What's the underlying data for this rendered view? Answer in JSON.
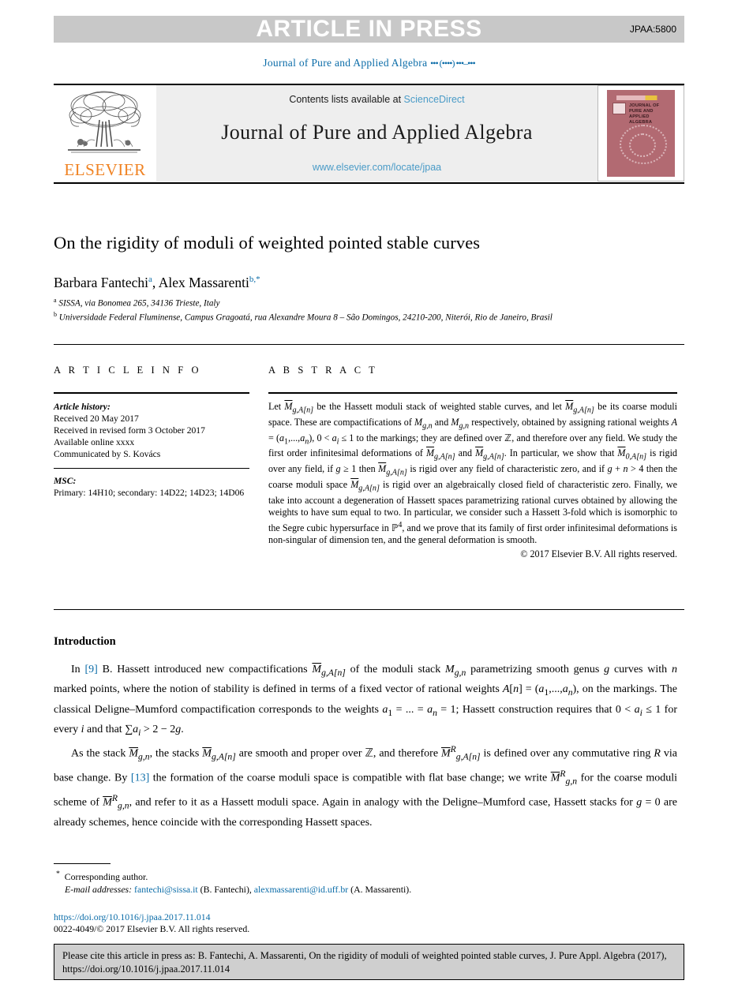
{
  "banner": {
    "text": "ARTICLE IN PRESS",
    "code": "JPAA:5800",
    "band_color": "#c8c8c8"
  },
  "running_head": {
    "journal": "Journal of Pure and Applied Algebra",
    "volume_dots": "••• (••••) •••–•••",
    "color": "#0b6ca8"
  },
  "masthead": {
    "contents_label": "Contents lists available at",
    "contents_link": "ScienceDirect",
    "journal_title": "Journal of Pure and Applied Algebra",
    "url": "www.elsevier.com/locate/jpaa",
    "publisher": "ELSEVIER",
    "publisher_color": "#f08323",
    "cover_title": "JOURNAL OF PURE AND APPLIED ALGEBRA",
    "cover_color": "#b26a72"
  },
  "article": {
    "title": "On the rigidity of moduli of weighted pointed stable curves",
    "authors_html": "Barbara Fantechi<sup>a</sup>, Alex Massarenti<sup>b,*</sup>",
    "affiliation_a": "SISSA, via Bonomea 265, 34136 Trieste, Italy",
    "affiliation_b": "Universidade Federal Fluminense, Campus Gragoatá, rua Alexandre Moura 8 – São Domingos, 24210-200, Niterói, Rio de Janeiro, Brasil"
  },
  "info": {
    "heading": "A R T I C L E   I N F O",
    "history_label": "Article history:",
    "received": "Received 20 May 2017",
    "revised": "Received in revised form 3 October 2017",
    "available": "Available online xxxx",
    "communicated": "Communicated by S. Kovács",
    "msc_label": "MSC:",
    "msc_codes": "Primary: 14H10; secondary: 14D22; 14D23; 14D06"
  },
  "abstract": {
    "heading": "A B S T R A C T",
    "copyright": "© 2017 Elsevier B.V. All rights reserved."
  },
  "introduction": {
    "heading": "Introduction"
  },
  "footnotes": {
    "corresponding": "Corresponding author.",
    "email_label": "E-mail addresses:",
    "email_1": "fantechi@sissa.it",
    "email_1_owner": "(B. Fantechi),",
    "email_2": "alexmassarenti@id.uff.br",
    "email_2_owner": "(A. Massarenti).",
    "doi": "https://doi.org/10.1016/j.jpaa.2017.11.014",
    "issn_line": "0022-4049/© 2017 Elsevier B.V. All rights reserved."
  },
  "cite_box": {
    "text": "Please cite this article in press as: B. Fantechi, A. Massarenti, On the rigidity of moduli of weighted pointed stable curves, J. Pure Appl. Algebra (2017), https://doi.org/10.1016/j.jpaa.2017.11.014"
  }
}
